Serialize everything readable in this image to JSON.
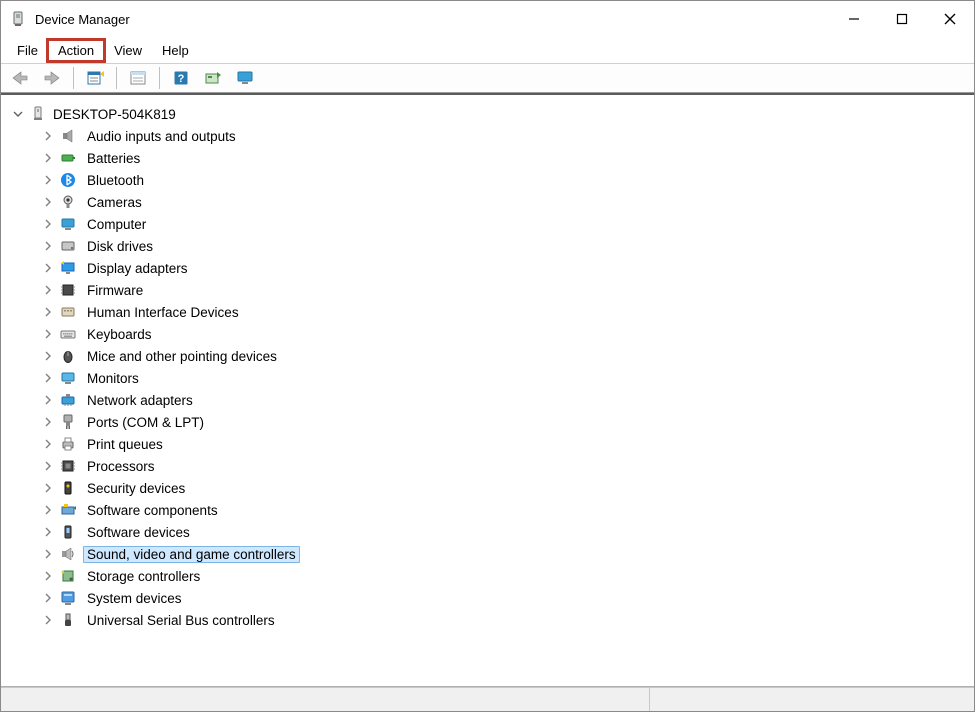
{
  "window": {
    "title": "Device Manager"
  },
  "menu": {
    "file": "File",
    "action": "Action",
    "view": "View",
    "help": "Help",
    "highlighted": "action"
  },
  "toolbar": {
    "back": "back-icon",
    "forward": "forward-icon",
    "properties": "properties-icon",
    "details": "details-icon",
    "help": "help-icon",
    "scan": "scan-icon",
    "monitor": "monitor-icon"
  },
  "tree": {
    "root": {
      "label": "DESKTOP-504K819",
      "expanded": true,
      "categories": [
        {
          "label": "Audio inputs and outputs",
          "icon": "speaker-icon",
          "expanded": false,
          "selected": false
        },
        {
          "label": "Batteries",
          "icon": "battery-icon",
          "expanded": false,
          "selected": false
        },
        {
          "label": "Bluetooth",
          "icon": "bluetooth-icon",
          "expanded": false,
          "selected": false
        },
        {
          "label": "Cameras",
          "icon": "camera-icon",
          "expanded": false,
          "selected": false
        },
        {
          "label": "Computer",
          "icon": "computer-icon",
          "expanded": false,
          "selected": false
        },
        {
          "label": "Disk drives",
          "icon": "disk-icon",
          "expanded": false,
          "selected": false
        },
        {
          "label": "Display adapters",
          "icon": "display-adapter-icon",
          "expanded": false,
          "selected": false
        },
        {
          "label": "Firmware",
          "icon": "firmware-icon",
          "expanded": false,
          "selected": false
        },
        {
          "label": "Human Interface Devices",
          "icon": "hid-icon",
          "expanded": false,
          "selected": false
        },
        {
          "label": "Keyboards",
          "icon": "keyboard-icon",
          "expanded": false,
          "selected": false
        },
        {
          "label": "Mice and other pointing devices",
          "icon": "mouse-icon",
          "expanded": false,
          "selected": false
        },
        {
          "label": "Monitors",
          "icon": "monitor-device-icon",
          "expanded": false,
          "selected": false
        },
        {
          "label": "Network adapters",
          "icon": "network-icon",
          "expanded": false,
          "selected": false
        },
        {
          "label": "Ports (COM & LPT)",
          "icon": "ports-icon",
          "expanded": false,
          "selected": false
        },
        {
          "label": "Print queues",
          "icon": "printer-icon",
          "expanded": false,
          "selected": false
        },
        {
          "label": "Processors",
          "icon": "processor-icon",
          "expanded": false,
          "selected": false
        },
        {
          "label": "Security devices",
          "icon": "security-icon",
          "expanded": false,
          "selected": false
        },
        {
          "label": "Software components",
          "icon": "software-component-icon",
          "expanded": false,
          "selected": false
        },
        {
          "label": "Software devices",
          "icon": "software-device-icon",
          "expanded": false,
          "selected": false
        },
        {
          "label": "Sound, video and game controllers",
          "icon": "sound-icon",
          "expanded": false,
          "selected": true
        },
        {
          "label": "Storage controllers",
          "icon": "storage-icon",
          "expanded": false,
          "selected": false
        },
        {
          "label": "System devices",
          "icon": "system-icon",
          "expanded": false,
          "selected": false
        },
        {
          "label": "Universal Serial Bus controllers",
          "icon": "usb-icon",
          "expanded": false,
          "selected": false
        }
      ]
    }
  }
}
